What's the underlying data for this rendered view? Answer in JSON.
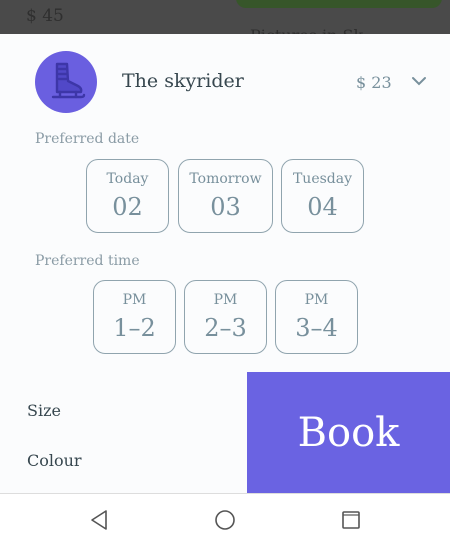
{
  "background": {
    "price": "$ 45",
    "caption": "Pictures in Sk"
  },
  "product": {
    "name": "The skyrider",
    "price": "$ 23",
    "icon": "ice-skate-icon",
    "avatar_color": "#6a5fe0"
  },
  "preferred_date": {
    "label": "Preferred date",
    "options": [
      {
        "day": "Today",
        "date": "02"
      },
      {
        "day": "Tomorrow",
        "date": "03"
      },
      {
        "day": "Tuesday",
        "date": "04"
      }
    ]
  },
  "preferred_time": {
    "label": "Preferred time",
    "options": [
      {
        "period": "PM",
        "range": "1–2"
      },
      {
        "period": "PM",
        "range": "2–3"
      },
      {
        "period": "PM",
        "range": "3–4"
      }
    ]
  },
  "attributes": {
    "size_label": "Size",
    "colour_label": "Colour"
  },
  "book_button": {
    "label": "Book",
    "color": "#6a63e2"
  },
  "navbar": {
    "icons": [
      "back-icon",
      "home-icon",
      "recents-icon"
    ]
  }
}
